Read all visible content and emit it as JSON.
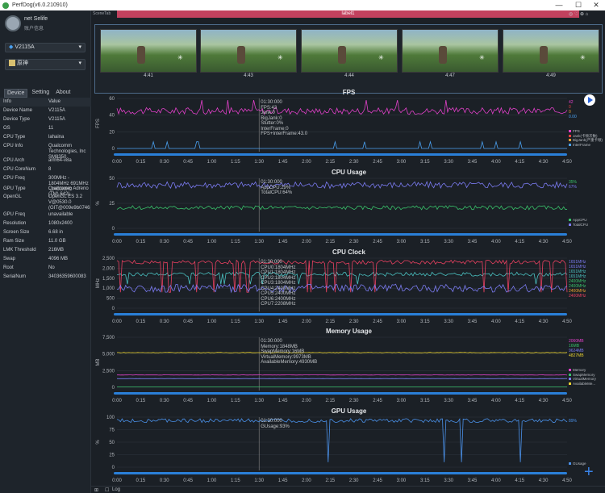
{
  "window": {
    "title": "PerfDog(v6.0.210910)",
    "min": "—",
    "max": "☐",
    "close": "✕"
  },
  "user": {
    "name": "net Selife",
    "sub": "账户信息"
  },
  "device_select": {
    "value": "V2115A"
  },
  "app_select": {
    "value": "原神"
  },
  "tabs": [
    "Device",
    "Setting",
    "About"
  ],
  "info_table": {
    "header": [
      "Info",
      "Value"
    ],
    "rows": [
      [
        "Device Name",
        "V2115A"
      ],
      [
        "Device Type",
        "V2115A"
      ],
      [
        "OS",
        "11"
      ],
      [
        "CPU Type",
        "lahaina"
      ],
      [
        "CPU Info",
        "Qualcomm Technologies, Inc SM8350"
      ],
      [
        "CPU Arch",
        "arm64-v8a"
      ],
      [
        "CPU CoreNum",
        "8"
      ],
      [
        "CPU Freq",
        "300MHz - 1804MHz 691MHz - 2400MHz"
      ],
      [
        "GPU Type",
        "Qualcomm Adreno (TM) 642L"
      ],
      [
        "OpenGL",
        "OpenGL ES 3.2 V@0530.0 (GIT@009e9b0746"
      ],
      [
        "GPU Freq",
        "unavailable"
      ],
      [
        "Resolution",
        "1080x2400"
      ],
      [
        "Screen Size",
        "6.68 in"
      ],
      [
        "Ram Size",
        "11.0 GB"
      ],
      [
        "LMK Threshold",
        "216MB"
      ],
      [
        "Swap",
        "4096 MB"
      ],
      [
        "Root",
        "No"
      ],
      [
        "SerialNum",
        "34036359600083"
      ]
    ]
  },
  "scene": {
    "tab": "SceneTab",
    "label": "label1",
    "times": [
      "4:41",
      "4:43",
      "4:44",
      "4:47",
      "4:49"
    ]
  },
  "time_axis": [
    "0:00",
    "0:15",
    "0:30",
    "0:45",
    "1:00",
    "1:15",
    "1:30",
    "1:45",
    "2:00",
    "2:15",
    "2:30",
    "2:45",
    "3:00",
    "3:15",
    "3:30",
    "3:45",
    "4:00",
    "4:15",
    "4:30",
    "4:50"
  ],
  "charts": {
    "fps": {
      "title": "FPS",
      "ylabel": "FPS",
      "yticks": [
        "0",
        "20",
        "40",
        "60"
      ],
      "info": "01:30:000\nFPS:43\nJank:0\nBigJank:0\nStutter:0%\nInterFrame:0\nFPS+InterFrame:43.0",
      "rvals": [
        {
          "v": "42",
          "c": "#e040c8"
        },
        {
          "v": "0",
          "c": "#e84040"
        },
        {
          "v": "0",
          "c": "#e8a030"
        },
        {
          "v": "0.00",
          "c": "#4aa0f0"
        }
      ],
      "legend": [
        {
          "n": "FPS",
          "c": "#e040c8"
        },
        {
          "n": "Jank(卡顿次数)",
          "c": "#e84040"
        },
        {
          "n": "BigJank(严重卡顿)",
          "c": "#e8a030"
        },
        {
          "n": "InterFrame",
          "c": "#4aa0f0"
        }
      ]
    },
    "cpu": {
      "title": "CPU Usage",
      "ylabel": "%",
      "yticks": [
        "0",
        "25",
        "50"
      ],
      "info": "01:30:000\nAppCPU:29%\nTotalCPU:64%",
      "rvals": [
        {
          "v": "35%",
          "c": "#39c06a"
        },
        {
          "v": "67%",
          "c": "#7a7af0"
        }
      ],
      "legend": [
        {
          "n": "AppCPU",
          "c": "#39c06a"
        },
        {
          "n": "TotalCPU",
          "c": "#7a7af0"
        }
      ]
    },
    "clock": {
      "title": "CPU Clock",
      "ylabel": "MHz",
      "yticks": [
        "0",
        "500",
        "1,000",
        "1,500",
        "2,000",
        "2,500"
      ],
      "info": "01:30:000\nCPU0:1804MHz\nCPU1:1804MHz\nCPU2:1804MHz\nCPU3:1804MHz\nCPU4:2400MHz\nCPU5:2400MHz\nCPU6:2400MHz\nCPU7:2208MHz",
      "rvals": [
        {
          "v": "1651MHz",
          "c": "#7a7af0"
        },
        {
          "v": "1651MHz",
          "c": "#7a7af0"
        },
        {
          "v": "1651MHz",
          "c": "#4ac0c0"
        },
        {
          "v": "1651MHz",
          "c": "#4ac0c0"
        },
        {
          "v": "2400MHz",
          "c": "#39c06a"
        },
        {
          "v": "2400MHz",
          "c": "#39c06a"
        },
        {
          "v": "2400MHz",
          "c": "#e8a030"
        },
        {
          "v": "2400MHz",
          "c": "#e84060"
        }
      ]
    },
    "mem": {
      "title": "Memory Usage",
      "ylabel": "MB",
      "yticks": [
        "0",
        "2,500",
        "5,000",
        "7,500"
      ],
      "info": "01:30:000\nMemory:1848MB\nSwapMemory:16MB\nVirtualMemory:9973MB\nAvailableMemory:4930MB",
      "rvals": [
        {
          "v": "2060MB",
          "c": "#e040c8"
        },
        {
          "v": "16MB",
          "c": "#39c06a"
        },
        {
          "v": "9624MB",
          "c": "#7a7af0"
        },
        {
          "v": "4827MB",
          "c": "#e8d030"
        }
      ],
      "legend": [
        {
          "n": "Memory",
          "c": "#e040c8"
        },
        {
          "n": "SwapMemory",
          "c": "#39c06a"
        },
        {
          "n": "VirtualMemory",
          "c": "#7a7af0"
        },
        {
          "n": "AvailableMe...",
          "c": "#e8d030"
        }
      ]
    },
    "gpu": {
      "title": "GPU Usage",
      "ylabel": "%",
      "yticks": [
        "0",
        "25",
        "50",
        "75",
        "100"
      ],
      "info": "01:30:000\nGUsage:93%",
      "rvals": [
        {
          "v": "89%",
          "c": "#4a90e8"
        }
      ],
      "legend": [
        {
          "n": "GUsage",
          "c": "#4a90e8"
        }
      ]
    }
  },
  "bottom": {
    "log": "Log"
  },
  "chart_data": [
    {
      "type": "line",
      "title": "FPS",
      "ylabel": "FPS",
      "ylim": [
        0,
        60
      ],
      "x": [
        "0:00",
        "1:30",
        "4:50"
      ],
      "series": [
        {
          "name": "FPS",
          "values": [
            45,
            43,
            42
          ]
        },
        {
          "name": "InterFrame",
          "values": [
            0,
            0,
            0
          ]
        }
      ]
    },
    {
      "type": "line",
      "title": "CPU Usage",
      "ylabel": "%",
      "ylim": [
        0,
        75
      ],
      "series": [
        {
          "name": "AppCPU",
          "values": [
            30,
            29,
            35
          ]
        },
        {
          "name": "TotalCPU",
          "values": [
            65,
            64,
            67
          ]
        }
      ]
    },
    {
      "type": "line",
      "title": "CPU Clock",
      "ylabel": "MHz",
      "ylim": [
        0,
        2500
      ]
    },
    {
      "type": "line",
      "title": "Memory Usage",
      "ylabel": "MB",
      "ylim": [
        0,
        7500
      ],
      "series": [
        {
          "name": "Memory",
          "values": [
            1800,
            1848,
            2060
          ]
        },
        {
          "name": "SwapMemory",
          "values": [
            16,
            16,
            16
          ]
        },
        {
          "name": "AvailableMemory",
          "values": [
            5200,
            4930,
            4827
          ]
        }
      ]
    },
    {
      "type": "line",
      "title": "GPU Usage",
      "ylabel": "%",
      "ylim": [
        0,
        100
      ],
      "series": [
        {
          "name": "GUsage",
          "values": [
            95,
            93,
            89
          ]
        }
      ]
    }
  ]
}
